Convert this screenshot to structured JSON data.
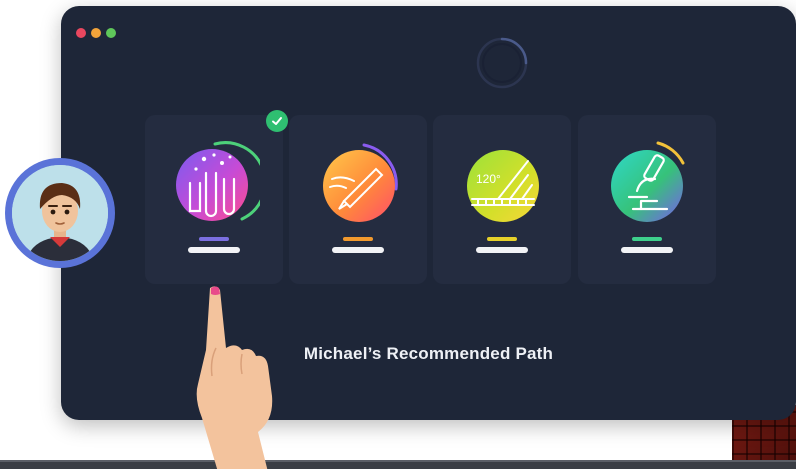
{
  "window": {
    "controls": [
      "close",
      "minimize",
      "maximize"
    ],
    "loading_indicator": "spinner-ring"
  },
  "cards": [
    {
      "topic": "science",
      "icon": "test-tubes-icon",
      "accent_color": "#7b6fe0",
      "completed": true
    },
    {
      "topic": "writing",
      "icon": "pen-icon",
      "accent_color": "#f29a2e",
      "completed": false
    },
    {
      "topic": "math",
      "icon": "protractor-icon",
      "accent_color": "#e6d12a",
      "completed": false,
      "icon_text": "120°"
    },
    {
      "topic": "biology",
      "icon": "microscope-icon",
      "accent_color": "#3ed08c",
      "completed": false
    }
  ],
  "path_label": "Michael’s Recommended Path",
  "avatar": {
    "name": "Michael"
  },
  "colors": {
    "window_bg": "#1e2638",
    "card_bg": "#242c40",
    "check_green": "#2fbf71",
    "avatar_ring": "#5a73d8"
  }
}
